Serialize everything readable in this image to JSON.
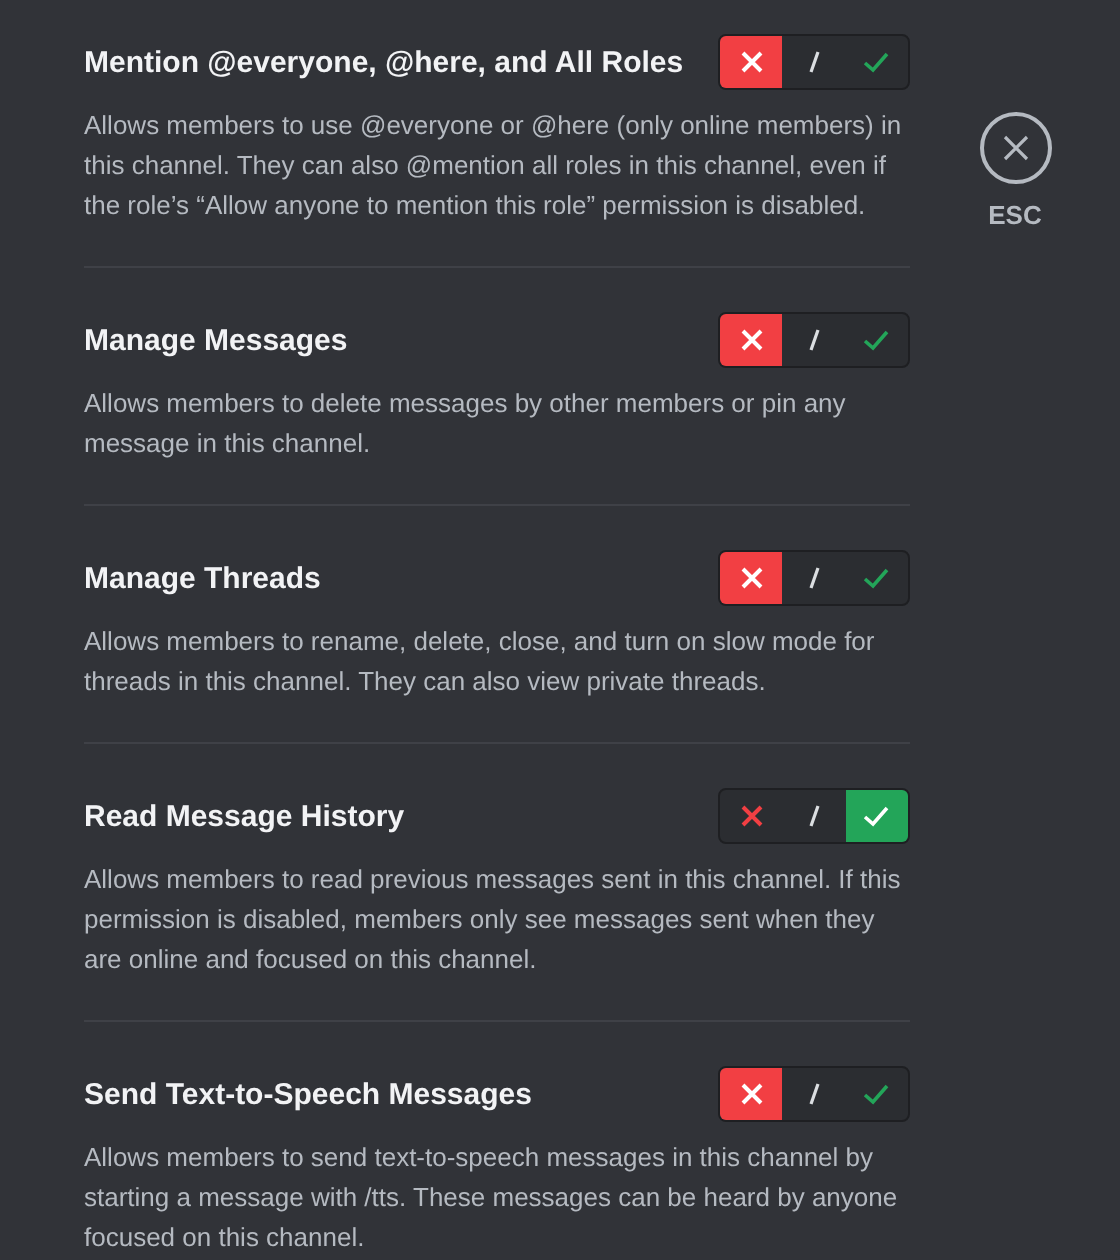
{
  "permissions": [
    {
      "title": "Mention @everyone, @here, and All Roles",
      "description": "Allows members to use @everyone or @here (only online members) in this channel. They can also @mention all roles in this channel, even if the role’s “Allow anyone to mention this role” permission is disabled.",
      "denied": true,
      "allowed": false
    },
    {
      "title": "Manage Messages",
      "description": "Allows members to delete messages by other members or pin any message in this channel.",
      "denied": true,
      "allowed": false
    },
    {
      "title": "Manage Threads",
      "description": "Allows members to rename, delete, close, and turn on slow mode for threads in this channel. They can also view private threads.",
      "denied": true,
      "allowed": false
    },
    {
      "title": "Read Message History",
      "description": "Allows members to read previous messages sent in this channel. If this permission is disabled, members only see messages sent when they are online and focused on this channel.",
      "denied": false,
      "allowed": true
    },
    {
      "title": "Send Text-to-Speech Messages",
      "description": "Allows members to send text-to-speech messages in this channel by starting a message with /tts. These messages can be heard by anyone focused on this channel.",
      "denied": true,
      "allowed": false
    }
  ],
  "close_button": {
    "label": "ESC"
  }
}
